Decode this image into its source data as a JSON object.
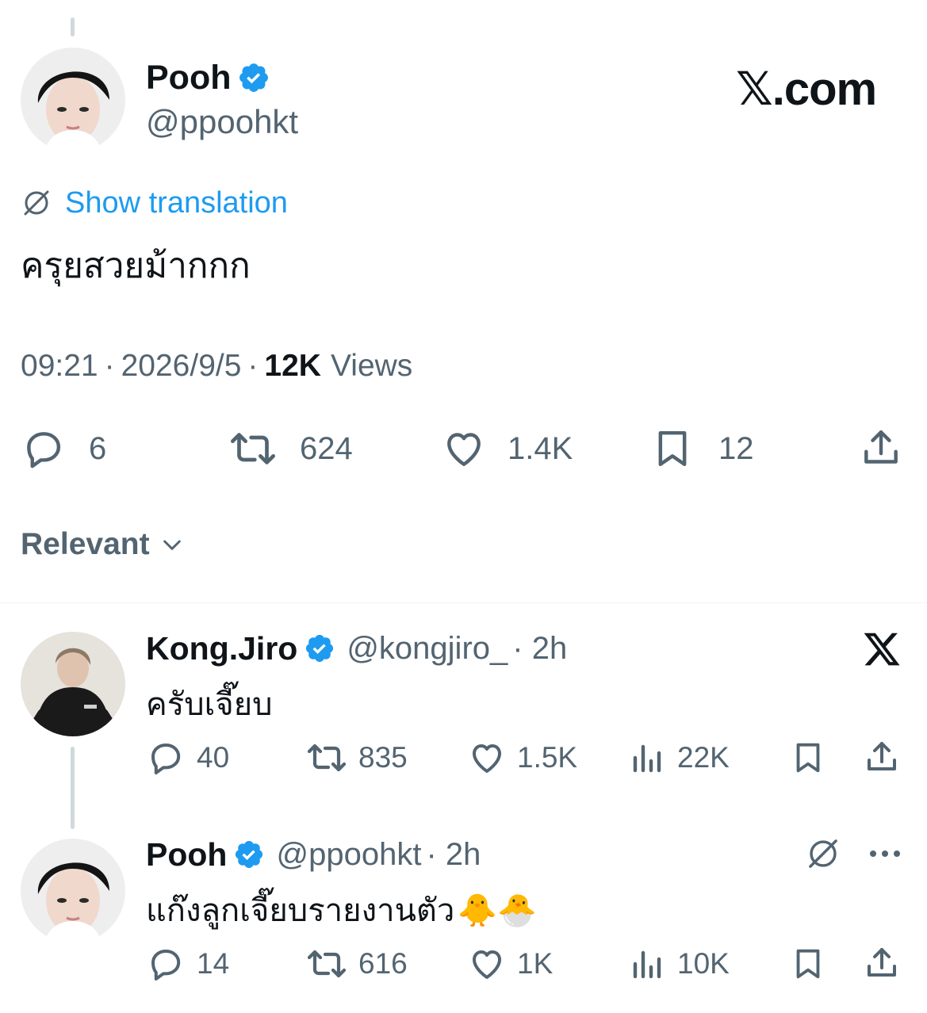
{
  "main_tweet": {
    "author": {
      "name": "Pooh",
      "handle": "@ppoohkt"
    },
    "watermark": "𝕏.com",
    "translate_label": "Show translation",
    "text": "ครุยสวยม้ากกก",
    "time": "09:21",
    "date": "2026/9/5",
    "views_count": "12K",
    "views_label": "Views",
    "separator": "·",
    "replies": "6",
    "retweets": "624",
    "likes": "1.4K",
    "bookmarks": "12"
  },
  "sort": {
    "label": "Relevant"
  },
  "replies": [
    {
      "name": "Kong.Jiro",
      "handle": "@kongjiro_",
      "time": "· 2h",
      "text": "ครับเจี๊ยบ",
      "replies": "40",
      "retweets": "835",
      "likes": "1.5K",
      "views": "22K"
    },
    {
      "name": "Pooh",
      "handle": "@ppoohkt",
      "time": "· 2h",
      "text": "แก๊งลูกเจี๊ยบรายงานตัว",
      "emoji": "🐥🐣",
      "replies": "14",
      "retweets": "616",
      "likes": "1K",
      "views": "10K"
    }
  ],
  "colors": {
    "text": "#0f1419",
    "muted": "#536471",
    "link": "#1d9bf0",
    "verified": "#1d9bf0",
    "divider": "#eff3f4",
    "thread_line": "#cfd9de"
  },
  "icons": [
    "verified-badge-icon",
    "translate-icon",
    "reply-icon",
    "retweet-icon",
    "like-icon",
    "bookmark-icon",
    "share-icon",
    "views-icon",
    "chevron-down-icon",
    "x-logo-icon",
    "more-icon"
  ]
}
